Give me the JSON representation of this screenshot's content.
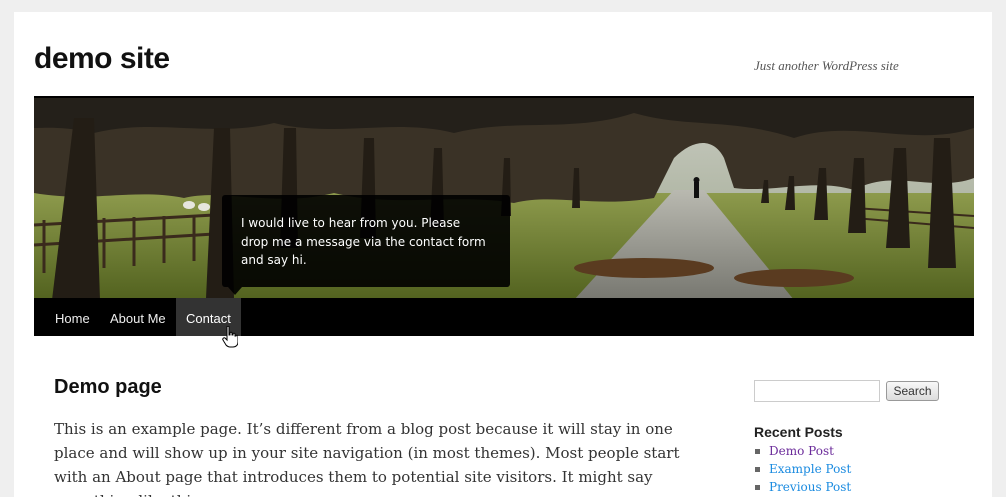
{
  "site": {
    "title": "demo site",
    "tagline": "Just another WordPress site"
  },
  "header": {
    "tooltip_text": "I would live to hear from you. Please drop me a message via the contact form and say hi."
  },
  "nav": {
    "items": [
      {
        "label": "Home",
        "active": false
      },
      {
        "label": "About Me",
        "active": false
      },
      {
        "label": "Contact",
        "active": true
      }
    ]
  },
  "content": {
    "title": "Demo page",
    "body": "This is an example page. It’s different from a blog post because it will stay in one place and will show up in your site navigation (in most themes). Most people start with an About page that introduces them to potential site visitors. It might say something like this:"
  },
  "sidebar": {
    "search": {
      "value": "",
      "button_label": "Search"
    },
    "recent_posts": {
      "title": "Recent Posts",
      "items": [
        "Demo Post",
        "Example Post",
        "Previous Post"
      ]
    }
  },
  "colors": {
    "nav_bg": "#000000",
    "nav_active_bg": "#333333",
    "link": "#1b8be0",
    "link_visited": "#6b2b9a"
  },
  "icons": {
    "cursor": "hand-pointer-icon"
  }
}
